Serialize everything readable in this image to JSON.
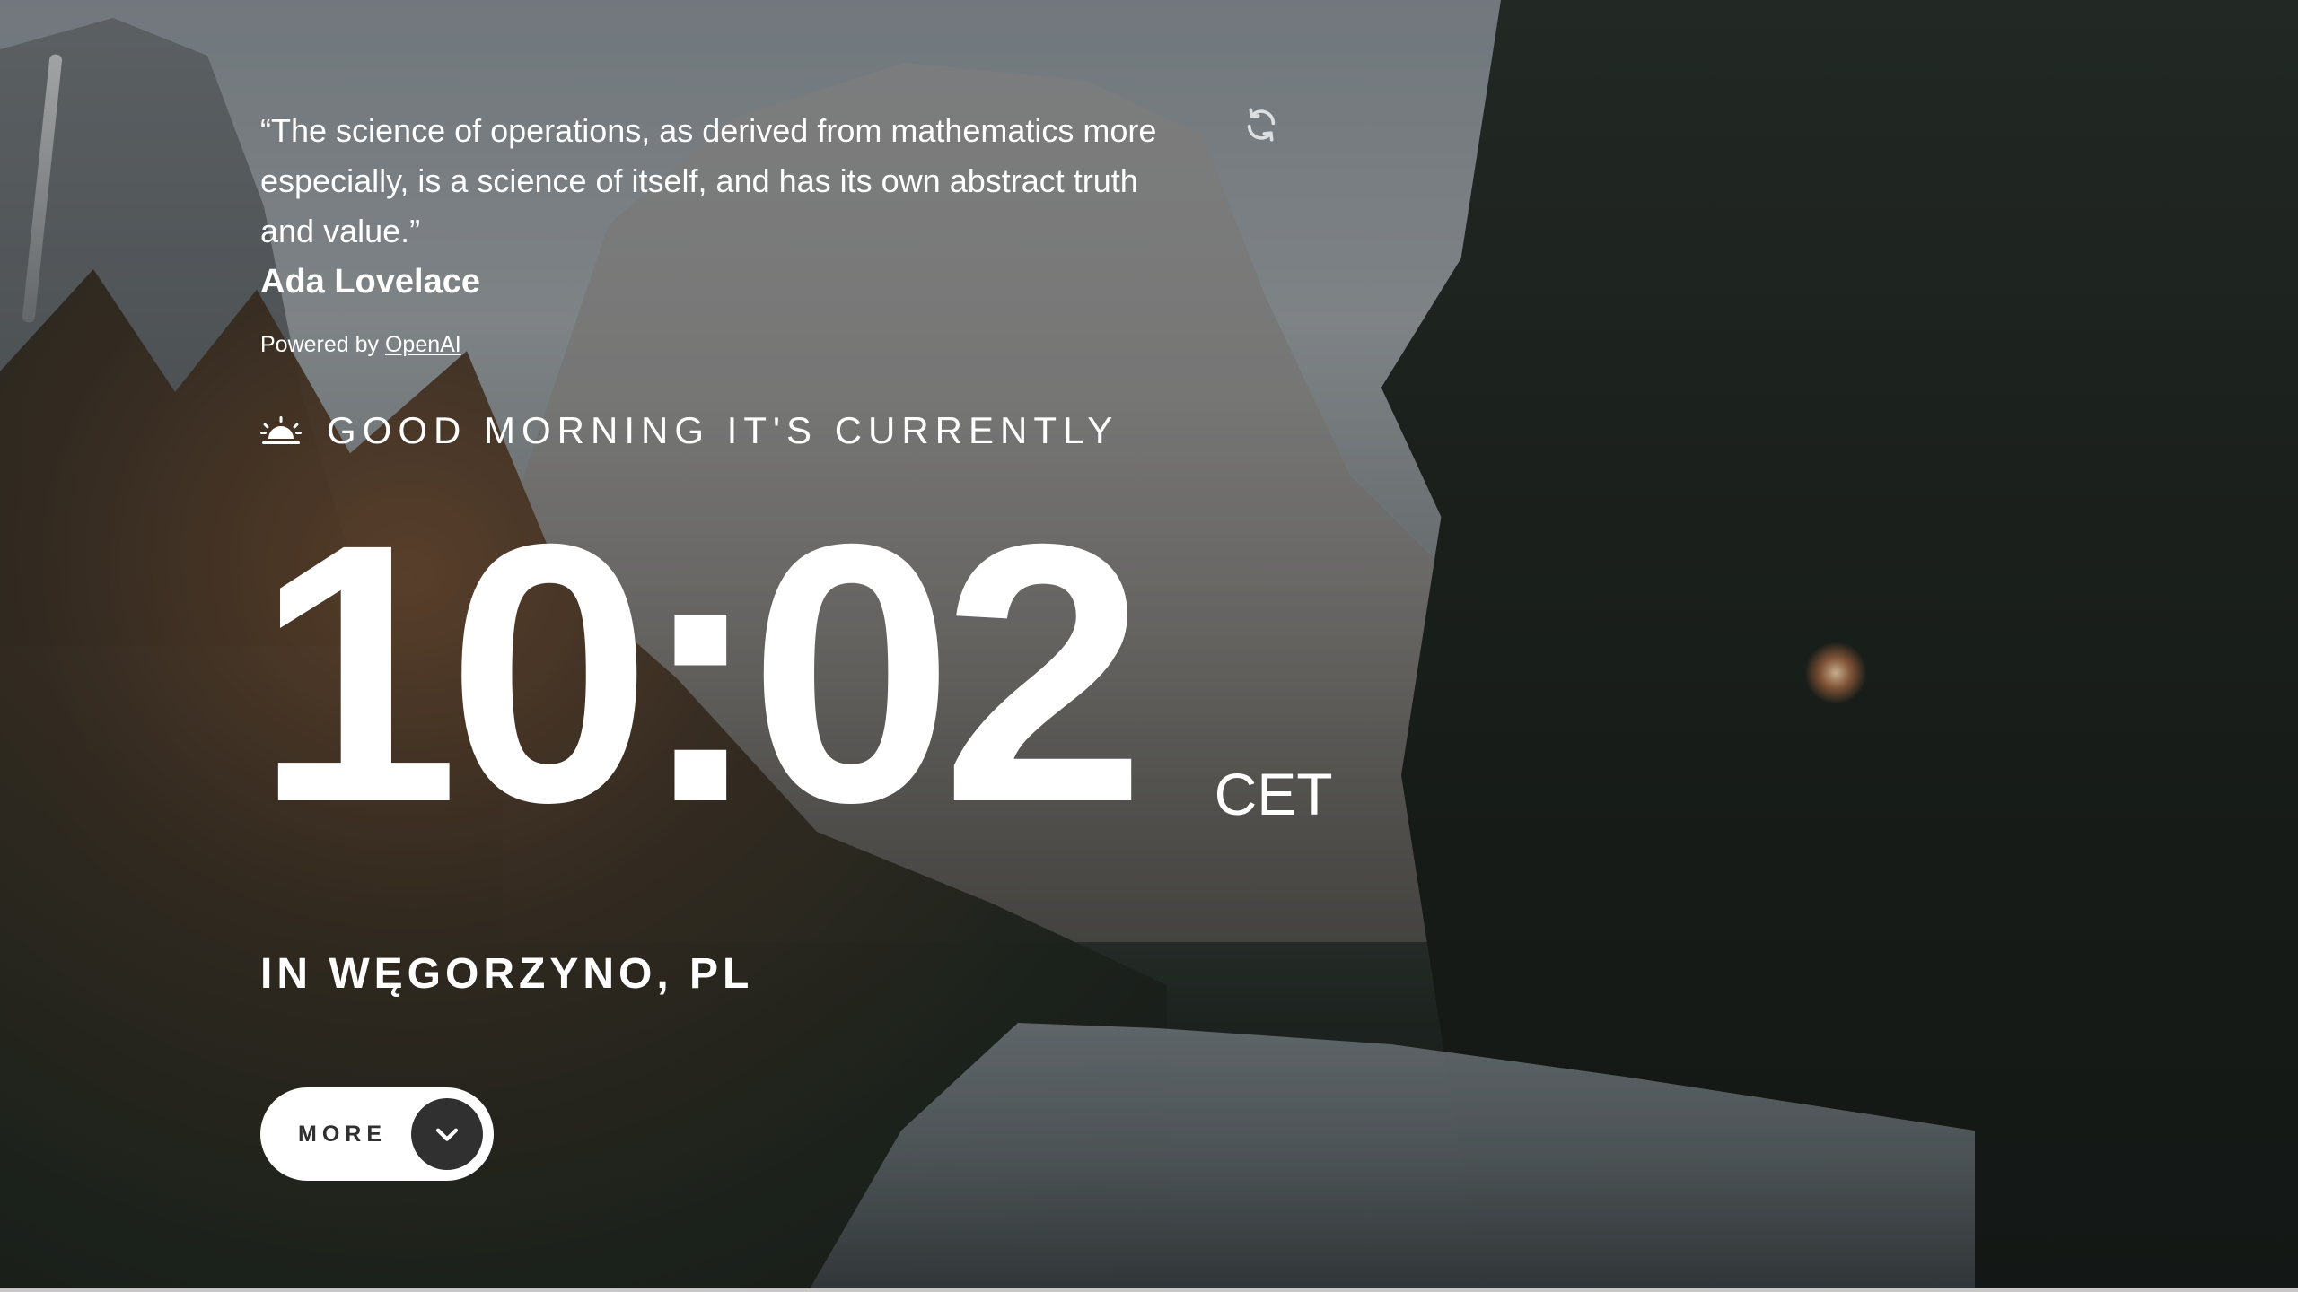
{
  "quote": {
    "text": "“The science of operations, as derived from mathematics more especially, is a science of itself, and has its own abstract truth and value.”",
    "author": "Ada Lovelace",
    "powered_prefix": "Powered by ",
    "powered_link": "OpenAI"
  },
  "refresh": {
    "icon": "refresh-icon"
  },
  "greeting": {
    "icon": "sunrise-icon",
    "text": "GOOD MORNING IT'S CURRENTLY"
  },
  "clock": {
    "time": "10:02",
    "timezone": "CET"
  },
  "location": {
    "text": "IN WĘGORZYNO, PL"
  },
  "more_button": {
    "label": "MORE",
    "icon": "chevron-down-icon"
  },
  "colors": {
    "text": "#ffffff",
    "button_bg": "#ffffff",
    "button_text": "#303030",
    "chevron_bg": "#303030"
  }
}
